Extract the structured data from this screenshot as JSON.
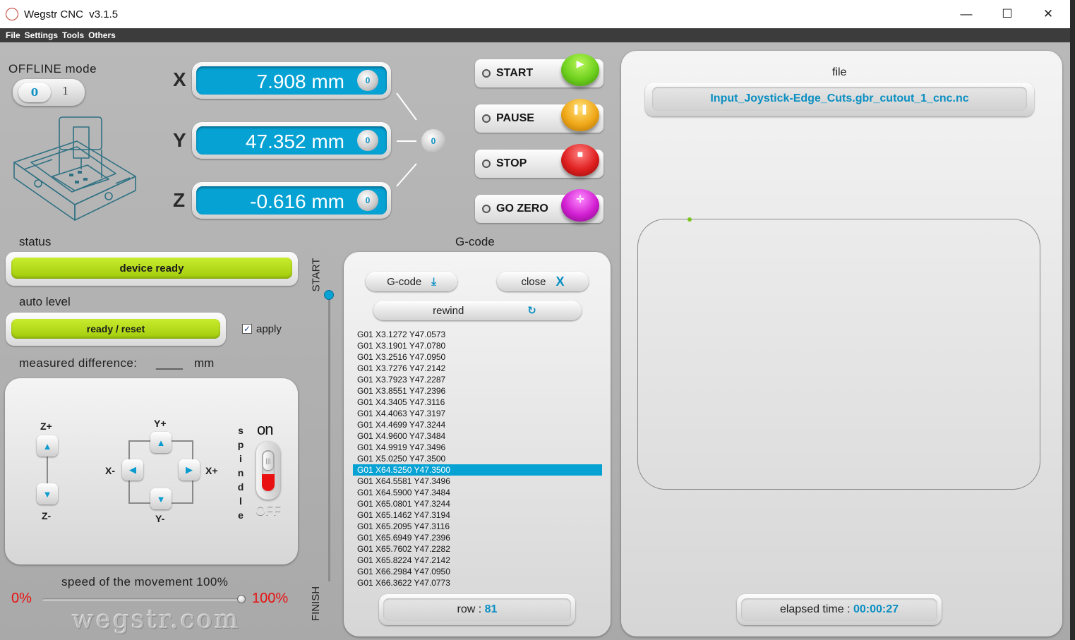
{
  "window": {
    "title": "Wegstr CNC  v3.1.5",
    "minimize": "—",
    "maximize": "☐",
    "close": "✕"
  },
  "menu": [
    "File",
    "Settings",
    "Tools",
    "Others"
  ],
  "mode": {
    "label": "OFFLINE mode",
    "toggle_off": "0",
    "toggle_on": "1"
  },
  "axes": {
    "x": {
      "letter": "X",
      "value": "7.908 mm",
      "zero": "0"
    },
    "y": {
      "letter": "Y",
      "value": "47.352 mm",
      "zero": "0"
    },
    "z": {
      "letter": "Z",
      "value": "-0.616 mm",
      "zero": "0"
    },
    "all_zero": "0"
  },
  "controls": {
    "start": "START",
    "pause": "PAUSE",
    "stop": "STOP",
    "go_zero": "GO ZERO"
  },
  "status": {
    "label": "status",
    "value": "device ready"
  },
  "auto_level": {
    "label": "auto level",
    "button": "ready / reset",
    "apply": "apply",
    "apply_checked": true
  },
  "measured": {
    "label": "measured difference:",
    "value": "____",
    "unit": "mm"
  },
  "jog": {
    "z_plus": "Z+",
    "z_minus": "Z-",
    "y_plus": "Y+",
    "y_minus": "Y-",
    "x_plus": "X+",
    "x_minus": "X-",
    "spindle_letters": [
      "s",
      "p",
      "i",
      "n",
      "d",
      "l",
      "e"
    ],
    "spindle_on": "on",
    "spindle_off": "OFF"
  },
  "speed": {
    "label": "speed of the movement 100%",
    "min": "0%",
    "max": "100%",
    "level": 1.0
  },
  "watermark": "wegstr.com",
  "progress": {
    "start": "START",
    "finish": "FINISH",
    "level": 0.0
  },
  "gcode": {
    "title": "G-code",
    "load_button": "G-code",
    "close_button": "close",
    "rewind_button": "rewind",
    "selected_index": 12,
    "lines": [
      "G01 X3.1272 Y47.0573",
      "G01 X3.1901 Y47.0780",
      "G01 X3.2516 Y47.0950",
      "G01 X3.7276 Y47.2142",
      "G01 X3.7923 Y47.2287",
      "G01 X3.8551 Y47.2396",
      "G01 X4.3405 Y47.3116",
      "G01 X4.4063 Y47.3197",
      "G01 X4.4699 Y47.3244",
      "G01 X4.9600 Y47.3484",
      "G01 X4.9919 Y47.3496",
      "G01 X5.0250 Y47.3500",
      "G01 X64.5250 Y47.3500",
      "G01 X64.5581 Y47.3496",
      "G01 X64.5900 Y47.3484",
      "G01 X65.0801 Y47.3244",
      "G01 X65.1462 Y47.3194",
      "G01 X65.2095 Y47.3116",
      "G01 X65.6949 Y47.2396",
      "G01 X65.7602 Y47.2282",
      "G01 X65.8224 Y47.2142",
      "G01 X66.2984 Y47.0950",
      "G01 X66.3622 Y47.0773"
    ],
    "row_label": "row :",
    "row_value": "81"
  },
  "file": {
    "label": "file",
    "name": "Input_Joystick-Edge_Cuts.gbr_cutout_1_cnc.nc",
    "elapsed_label": "elapsed time :",
    "elapsed_value": "00:00:27"
  },
  "colors": {
    "accent": "#06a2d4",
    "ready_green": "#b3dc1c",
    "start": "#6fd11e",
    "pause": "#f0a818",
    "stop": "#e02020",
    "go_zero": "#d21fd2",
    "offset_red": "#e81010",
    "path_dot": "#7ac51e"
  }
}
